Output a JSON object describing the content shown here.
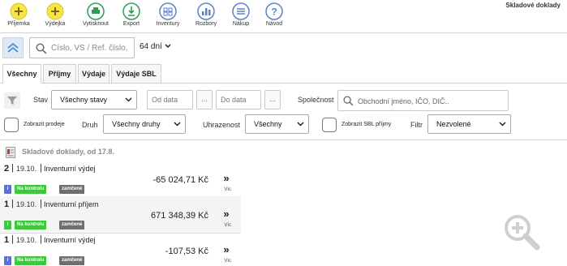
{
  "app": {
    "title": "Skladové doklady"
  },
  "toolbar": [
    {
      "name": "prijemka",
      "label": "Příjemka",
      "icon": "plus-circle-icon",
      "color": "#f7e34a"
    },
    {
      "name": "vydejka",
      "label": "Výdejka",
      "icon": "plus-circle-icon",
      "color": "#f7e34a"
    },
    {
      "name": "vytisknout",
      "label": "Vytisknout",
      "icon": "printer-icon",
      "color": "#2e9b52"
    },
    {
      "name": "export",
      "label": "Export",
      "icon": "export-icon",
      "color": "#2e9b52"
    },
    {
      "name": "inventury",
      "label": "Inventury",
      "icon": "inventory-icon",
      "color": "#5b82c7"
    },
    {
      "name": "rozbory",
      "label": "Rozbory",
      "icon": "bar-chart-icon",
      "color": "#5b82c7"
    },
    {
      "name": "nakup",
      "label": "Nákup",
      "icon": "menu-lines-icon",
      "color": "#5b82c7"
    },
    {
      "name": "navod",
      "label": "Návod",
      "icon": "question-icon",
      "color": "#5b82c7"
    }
  ],
  "search": {
    "placeholder": "Číslo, VS / Ref. číslo,",
    "days": "64 dní"
  },
  "tabs": [
    {
      "label": "Všechny",
      "active": true
    },
    {
      "label": "Příjmy",
      "active": false
    },
    {
      "label": "Výdaje",
      "active": false
    },
    {
      "label": "Výdaje SBL",
      "active": false
    }
  ],
  "filters": {
    "stav_label": "Stav",
    "stav_value": "Všechny stavy",
    "date_from_placeholder": "Od data",
    "date_to_placeholder": "Do data",
    "dots": "...",
    "spolecnost_label": "Společnost",
    "spolecnost_placeholder": "Obchodní jméno, IČO, DIČ..",
    "zobrazit_prodeje": "Zobrazit prodeje",
    "druh_label": "Druh",
    "druh_value": "Všechny druhy",
    "uhrazenost_label": "Uhrazenost",
    "uhrazenost_value": "Všechny",
    "zobrazit_sbl": "Zobrazit SBL příjmy",
    "filtr_label": "Filtr",
    "filtr_value": "Nezvolené"
  },
  "list": {
    "heading": "Skladové doklady, od 17.8.",
    "more_label": "Víc",
    "items": [
      {
        "count": "2",
        "date": "19.10.",
        "title": "Inventurní výdej",
        "amount": "-65 024,71 Kč",
        "badge_i": "I",
        "badge_i_color": "#5b6fd6",
        "badge_kontrola": "Na kontrolu",
        "badge_zamcene": "zamčené"
      },
      {
        "count": "1",
        "date": "19.10.",
        "title": "Inventurní příjem",
        "amount": "671 348,39 Kč",
        "badge_i": "I",
        "badge_i_color": "#3cc83c",
        "badge_kontrola": "Na kontrolu",
        "badge_zamcene": "zamčené"
      },
      {
        "count": "1",
        "date": "19.10.",
        "title": "Inventurní výdej",
        "amount": "-107,53 Kč",
        "badge_i": "I",
        "badge_i_color": "#5b6fd6",
        "badge_kontrola": "Na kontrolu",
        "badge_zamcene": "zamčené"
      }
    ]
  }
}
